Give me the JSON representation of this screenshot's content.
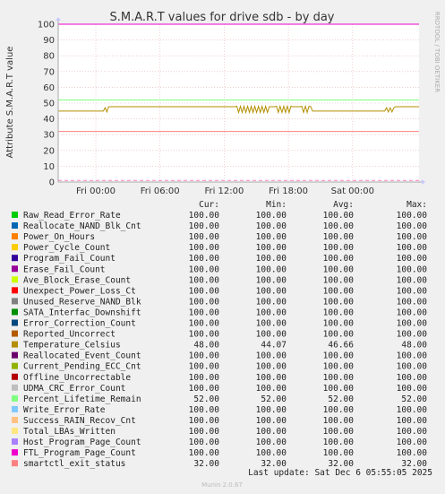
{
  "chart_data": {
    "type": "line",
    "title": "S.M.A.R.T values for drive sdb - by day",
    "ylabel": "Attribute S.M.A.R.T value",
    "xlabel": "",
    "ylim": [
      0,
      100
    ],
    "yticks": [
      "0",
      "10",
      "20",
      "30",
      "40",
      "50",
      "60",
      "70",
      "80",
      "90",
      "100"
    ],
    "xticks": [
      "Fri 00:00",
      "Fri 06:00",
      "Fri 12:00",
      "Fri 18:00",
      "Sat 00:00"
    ],
    "grid": true,
    "side_label": "RRDTOOL / TOBI OETIKER",
    "columns": [
      "Cur:",
      "Min:",
      "Avg:",
      "Max:"
    ],
    "series": [
      {
        "name": "Raw_Read_Error_Rate",
        "color": "#00cc00",
        "cur": "100.00",
        "min": "100.00",
        "avg": "100.00",
        "max": "100.00",
        "value": 100
      },
      {
        "name": "Reallocate_NAND_Blk_Cnt",
        "color": "#0066b3",
        "cur": "100.00",
        "min": "100.00",
        "avg": "100.00",
        "max": "100.00",
        "value": 100
      },
      {
        "name": "Power_On_Hours",
        "color": "#ff8000",
        "cur": "100.00",
        "min": "100.00",
        "avg": "100.00",
        "max": "100.00",
        "value": 100
      },
      {
        "name": "Power_Cycle_Count",
        "color": "#ffcc00",
        "cur": "100.00",
        "min": "100.00",
        "avg": "100.00",
        "max": "100.00",
        "value": 100
      },
      {
        "name": "Program_Fail_Count",
        "color": "#330099",
        "cur": "100.00",
        "min": "100.00",
        "avg": "100.00",
        "max": "100.00",
        "value": 100
      },
      {
        "name": "Erase_Fail_Count",
        "color": "#990099",
        "cur": "100.00",
        "min": "100.00",
        "avg": "100.00",
        "max": "100.00",
        "value": 100
      },
      {
        "name": "Ave_Block_Erase_Count",
        "color": "#ccff00",
        "cur": "100.00",
        "min": "100.00",
        "avg": "100.00",
        "max": "100.00",
        "value": 100
      },
      {
        "name": "Unexpect_Power_Loss_Ct",
        "color": "#ff0000",
        "cur": "100.00",
        "min": "100.00",
        "avg": "100.00",
        "max": "100.00",
        "value": 100
      },
      {
        "name": "Unused_Reserve_NAND_Blk",
        "color": "#808080",
        "cur": "100.00",
        "min": "100.00",
        "avg": "100.00",
        "max": "100.00",
        "value": 100
      },
      {
        "name": "SATA_Interfac_Downshift",
        "color": "#008f00",
        "cur": "100.00",
        "min": "100.00",
        "avg": "100.00",
        "max": "100.00",
        "value": 100
      },
      {
        "name": "Error_Correction_Count",
        "color": "#00487d",
        "cur": "100.00",
        "min": "100.00",
        "avg": "100.00",
        "max": "100.00",
        "value": 100
      },
      {
        "name": "Reported_Uncorrect",
        "color": "#b35a00",
        "cur": "100.00",
        "min": "100.00",
        "avg": "100.00",
        "max": "100.00",
        "value": 100
      },
      {
        "name": "Temperature_Celsius",
        "color": "#b38f00",
        "cur": "48.00",
        "min": "44.07",
        "avg": "46.66",
        "max": "48.00",
        "value": 46.66
      },
      {
        "name": "Reallocated_Event_Count",
        "color": "#6b006b",
        "cur": "100.00",
        "min": "100.00",
        "avg": "100.00",
        "max": "100.00",
        "value": 100
      },
      {
        "name": "Current_Pending_ECC_Cnt",
        "color": "#8fb300",
        "cur": "100.00",
        "min": "100.00",
        "avg": "100.00",
        "max": "100.00",
        "value": 100
      },
      {
        "name": "Offline_Uncorrectable",
        "color": "#b30000",
        "cur": "100.00",
        "min": "100.00",
        "avg": "100.00",
        "max": "100.00",
        "value": 100
      },
      {
        "name": "UDMA_CRC_Error_Count",
        "color": "#bebebe",
        "cur": "100.00",
        "min": "100.00",
        "avg": "100.00",
        "max": "100.00",
        "value": 100
      },
      {
        "name": "Percent_Lifetime_Remain",
        "color": "#80ff80",
        "cur": "52.00",
        "min": "52.00",
        "avg": "52.00",
        "max": "52.00",
        "value": 52
      },
      {
        "name": "Write_Error_Rate",
        "color": "#80c9ff",
        "cur": "100.00",
        "min": "100.00",
        "avg": "100.00",
        "max": "100.00",
        "value": 100
      },
      {
        "name": "Success_RAIN_Recov_Cnt",
        "color": "#ffc080",
        "cur": "100.00",
        "min": "100.00",
        "avg": "100.00",
        "max": "100.00",
        "value": 100
      },
      {
        "name": "Total_LBAs_Written",
        "color": "#ffe680",
        "cur": "100.00",
        "min": "100.00",
        "avg": "100.00",
        "max": "100.00",
        "value": 100
      },
      {
        "name": "Host_Program_Page_Count",
        "color": "#aa80ff",
        "cur": "100.00",
        "min": "100.00",
        "avg": "100.00",
        "max": "100.00",
        "value": 100
      },
      {
        "name": "FTL_Program_Page_Count",
        "color": "#ee00cc",
        "cur": "100.00",
        "min": "100.00",
        "avg": "100.00",
        "max": "100.00",
        "value": 100
      },
      {
        "name": "smartctl_exit_status",
        "color": "#ff8080",
        "cur": "32.00",
        "min": "32.00",
        "avg": "32.00",
        "max": "32.00",
        "value": 32
      }
    ],
    "reference_lines": [
      {
        "value": 1,
        "color": "#ff80c0",
        "style": "dashed"
      }
    ],
    "last_update": "Last update: Sat Dec  6 05:55:05 2025",
    "footer": "Munin 2.0.67"
  }
}
